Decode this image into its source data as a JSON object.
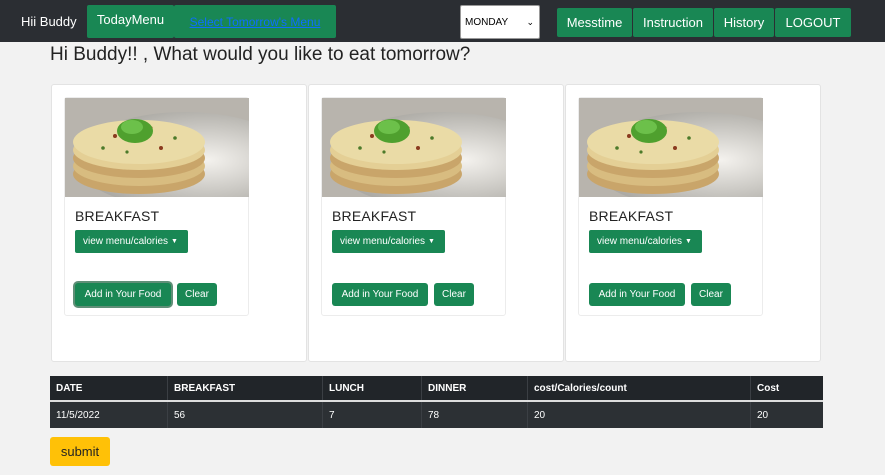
{
  "navbar": {
    "brand": "Hii Buddy",
    "today_menu": "TodayMenu",
    "select_tomorrow": "Select Tomorrow's Menu",
    "day_select": "MONDAY",
    "messtime": "Messtime",
    "instruction": "Instruction",
    "history": "History",
    "logout": "LOGOUT"
  },
  "heading": "Hi Buddy!! , What would you like to eat tomorrow?",
  "cards": [
    {
      "title": "BREAKFAST",
      "dropdown": "view menu/calories",
      "add": "Add in Your Food",
      "clear": "Clear"
    },
    {
      "title": "BREAKFAST",
      "dropdown": "view menu/calories",
      "add": "Add in Your Food",
      "clear": "Clear"
    },
    {
      "title": "BREAKFAST",
      "dropdown": "view menu/calories",
      "add": "Add in Your Food",
      "clear": "Clear"
    }
  ],
  "table": {
    "headers": [
      "DATE",
      "BREAKFAST",
      "LUNCH",
      "DINNER",
      "cost/Calories/count",
      "Cost"
    ],
    "rows": [
      [
        "11/5/2022",
        "56",
        "7",
        "78",
        "20",
        "20"
      ]
    ]
  },
  "submit": "submit",
  "colors": {
    "navbar": "#2b2e33",
    "accent": "#198754",
    "submit": "#ffc107",
    "table_dark": "#212529"
  }
}
